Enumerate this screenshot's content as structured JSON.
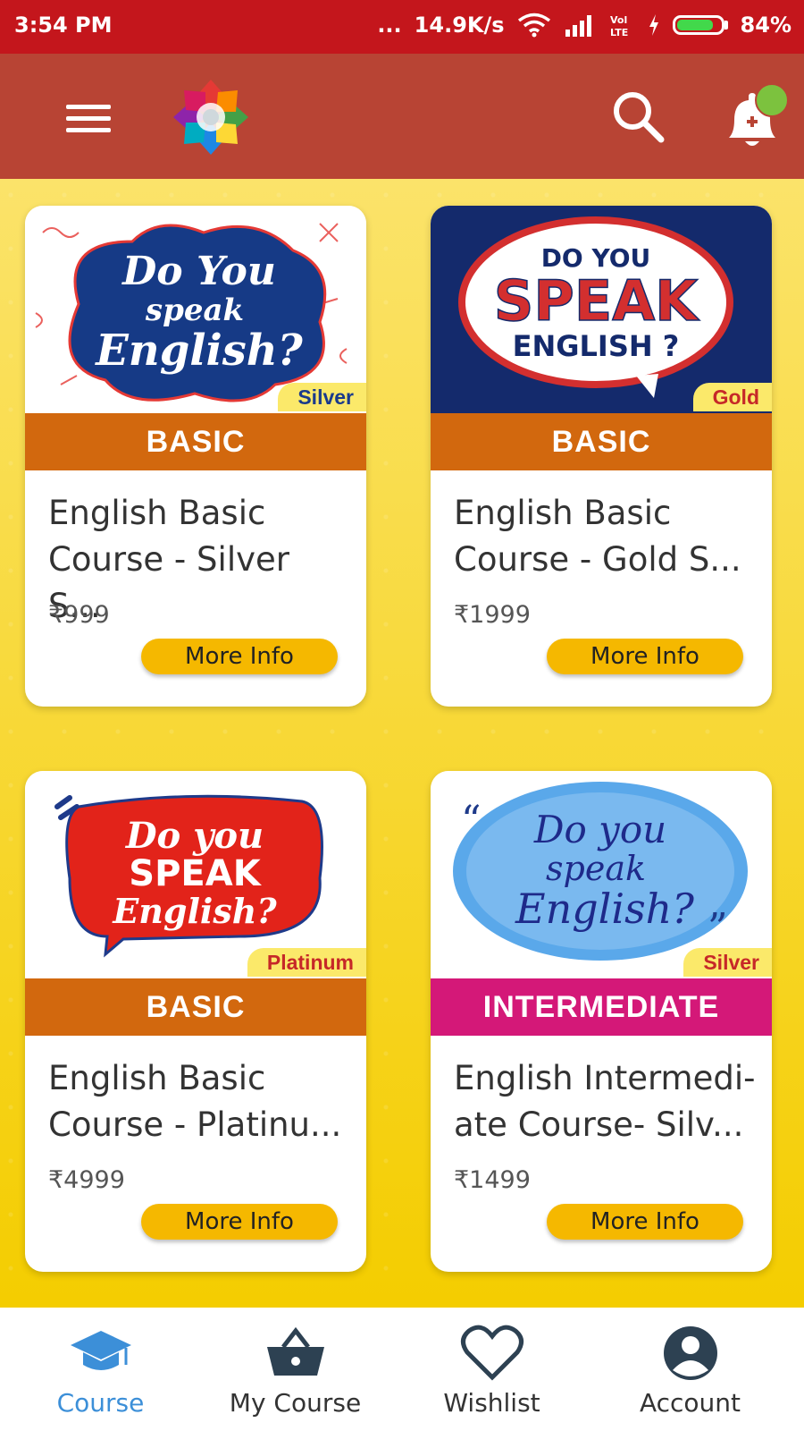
{
  "status_bar": {
    "time": "3:54 PM",
    "dots": "...",
    "speed": "14.9K/s",
    "network_type": "Vol LTE",
    "battery_percent": "84%",
    "battery_level": 0.84
  },
  "app_bar": {
    "menu_icon": "hamburger-menu-icon",
    "logo_icon": "app-logo",
    "search_icon": "search-icon",
    "notification_icon": "bell-icon"
  },
  "courses": [
    {
      "banner_text": [
        "Do You",
        "speak",
        "English?"
      ],
      "tier": "Silver",
      "level": "BASIC",
      "title_line1": "English Basic",
      "title_line2": "Course - Silver S...",
      "price": "₹999",
      "button": "More Info"
    },
    {
      "banner_text": [
        "DO YOU",
        "SPEAK",
        "ENGLISH ?"
      ],
      "tier": "Gold",
      "level": "BASIC",
      "title_line1": "English Basic",
      "title_line2": "Course - Gold S...",
      "price": "₹1999",
      "button": "More Info"
    },
    {
      "banner_text": [
        "Do you",
        "SPEAK",
        "English?"
      ],
      "tier": "Platinum",
      "level": "BASIC",
      "title_line1": "English Basic",
      "title_line2": "Course - Platinu...",
      "price": "₹4999",
      "button": "More Info"
    },
    {
      "banner_text": [
        "Do you",
        "speak",
        "English?"
      ],
      "tier": "Silver",
      "level": "INTERMEDIATE",
      "title_line1": "English Intermedi-",
      "title_line2": "ate Course- Silv...",
      "price": "₹1499",
      "button": "More Info"
    }
  ],
  "bottom_nav": [
    {
      "label": "Course",
      "icon": "graduation-cap-icon",
      "active": true
    },
    {
      "label": "My Course",
      "icon": "basket-icon",
      "active": false
    },
    {
      "label": "Wishlist",
      "icon": "heart-icon",
      "active": false
    },
    {
      "label": "Account",
      "icon": "account-circle-icon",
      "active": false
    }
  ],
  "colors": {
    "status_bar": "#c4161c",
    "app_bar": "#b84434",
    "background": "#f6d500",
    "level_basic": "#d2680e",
    "level_intermediate": "#d41878",
    "button": "#f5b800",
    "active_nav": "#3c8fd8"
  }
}
